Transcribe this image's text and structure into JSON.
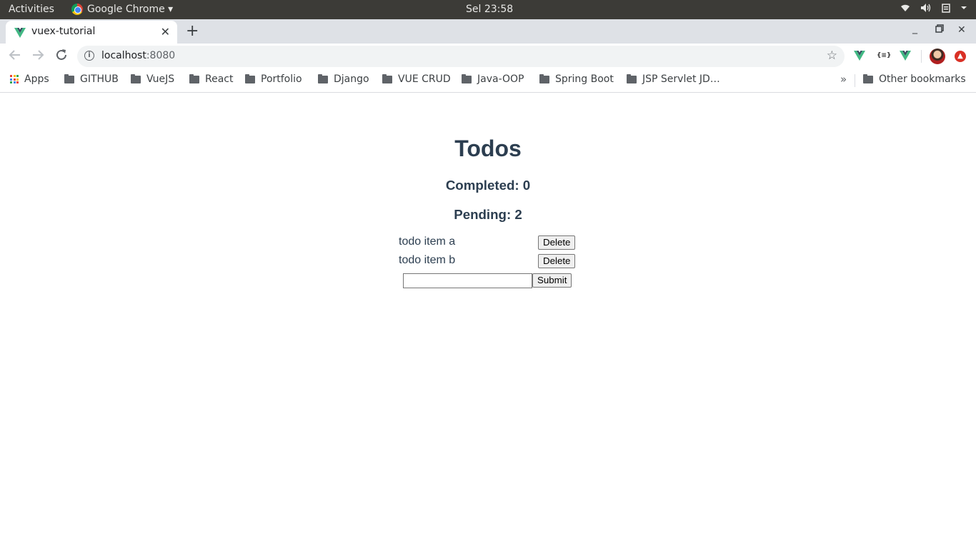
{
  "system_bar": {
    "activities": "Activities",
    "app_name": "Google Chrome ▾",
    "clock": "Sel 23:58",
    "icons": [
      "wifi-icon",
      "volume-icon",
      "clipboard-icon",
      "menu-caret-icon"
    ]
  },
  "browser": {
    "tab_title": "vuex-tutorial",
    "url_host": "localhost",
    "url_port": ":8080",
    "bookmarks": [
      "GITHUB",
      "VueJS",
      "React",
      "Portfolio",
      "Django",
      "VUE CRUD",
      "Java-OOP",
      "Spring Boot",
      "JSP Servlet JD…"
    ],
    "apps_label": "Apps",
    "more_label": "»",
    "other_bookmarks": "Other bookmarks",
    "ext_json_label": "{≡}",
    "colors": {
      "vue_green": "#41b883",
      "vue_dark": "#35495e"
    }
  },
  "page": {
    "title": "Todos",
    "completed": "Completed: 0",
    "pending": "Pending: 2",
    "todos": [
      {
        "text": "todo item a",
        "button": "Delete"
      },
      {
        "text": "todo item b",
        "button": "Delete"
      }
    ],
    "input_value": "",
    "submit_label": "Submit",
    "text_color": "#2c3e50"
  }
}
